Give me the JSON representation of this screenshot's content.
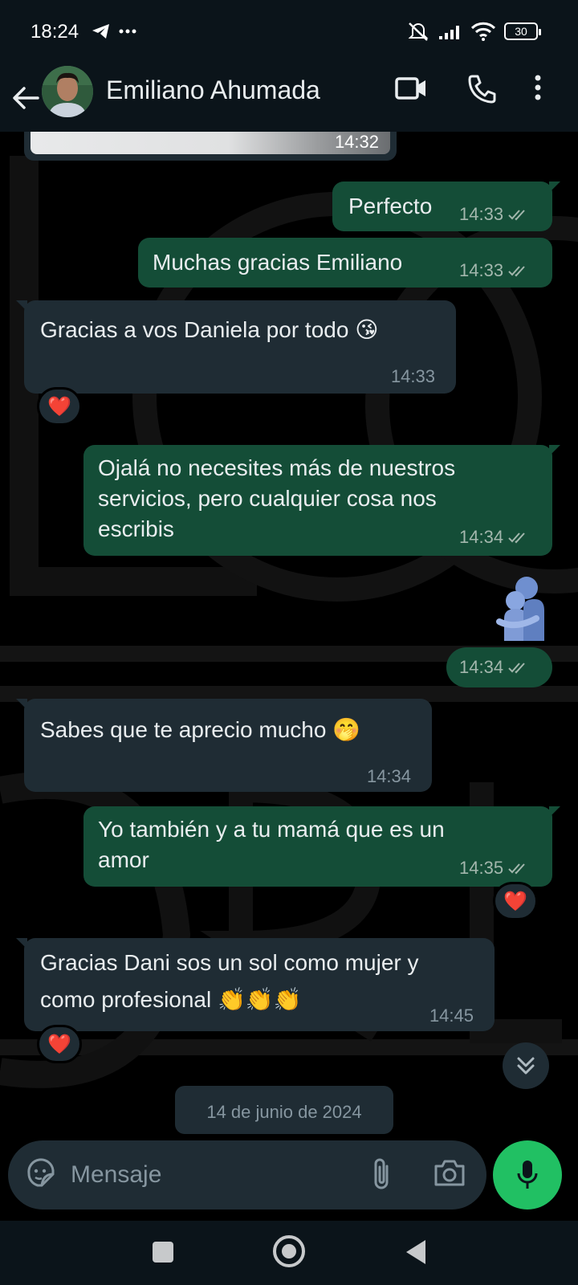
{
  "status_bar": {
    "time": "18:24",
    "battery": "30",
    "icons": [
      "telegram-icon",
      "more-dots-icon",
      "mute-icon",
      "signal-icon",
      "wifi-icon",
      "battery-icon"
    ]
  },
  "header": {
    "contact_name": "Emiliano Ahumada",
    "icons": [
      "back-arrow-icon",
      "video-call-icon",
      "voice-call-icon",
      "more-vertical-icon"
    ]
  },
  "messages": [
    {
      "id": "m0",
      "direction": "in",
      "type": "image",
      "time": "14:32"
    },
    {
      "id": "m1",
      "direction": "out",
      "text": "Perfecto",
      "time": "14:33",
      "status": "read"
    },
    {
      "id": "m2",
      "direction": "out",
      "text": "Muchas gracias Emiliano",
      "time": "14:33",
      "status": "read"
    },
    {
      "id": "m3",
      "direction": "in",
      "text": "Gracias a vos Daniela por todo",
      "emoji": "😘",
      "time": "14:33",
      "reaction": "❤️"
    },
    {
      "id": "m4",
      "direction": "out",
      "lines": [
        "Ojalá no necesites más de nuestros",
        "servicios, pero cualquier cosa nos",
        "escribis"
      ],
      "time": "14:34",
      "status": "read"
    },
    {
      "id": "m5",
      "direction": "out",
      "type": "sticker",
      "sticker": "🫂",
      "time": "14:34",
      "status": "read"
    },
    {
      "id": "m6",
      "direction": "in",
      "text": "Sabes que te aprecio mucho",
      "emoji": "🤭",
      "time": "14:34"
    },
    {
      "id": "m7",
      "direction": "out",
      "lines": [
        "Yo también y a tu mamá que es un",
        "amor"
      ],
      "time": "14:35",
      "status": "read",
      "reaction": "❤️"
    },
    {
      "id": "m8",
      "direction": "in",
      "lines": [
        "Gracias Dani sos un sol como mujer y",
        "como profesional 👏👏👏"
      ],
      "time": "14:45",
      "reaction": "❤️"
    }
  ],
  "date_chip": "14 de junio de 2024",
  "input": {
    "placeholder": "Mensaje"
  },
  "colors": {
    "outgoing_bubble": "#144d37",
    "incoming_bubble": "#1f2c34",
    "header_bg": "#0b141a",
    "mic_button": "#21c063",
    "read_ticks": "#a3b7ad"
  }
}
